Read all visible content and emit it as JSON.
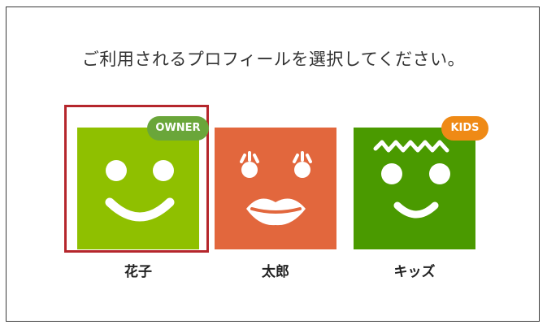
{
  "prompt": "ご利用されるプロフィールを選択してください。",
  "colors": {
    "selected_border": "#b5262c",
    "owner_avatar": "#8fc000",
    "taro_avatar": "#e2673d",
    "kids_avatar": "#4a9a00",
    "owner_badge": "#6aa63a",
    "kids_badge": "#ef8a16"
  },
  "profiles": [
    {
      "name": "花子",
      "badge": "OWNER",
      "icon": "smiley-face-icon",
      "selected": true
    },
    {
      "name": "太郎",
      "badge": "",
      "icon": "lips-face-icon",
      "selected": false
    },
    {
      "name": "キッズ",
      "badge": "KIDS",
      "icon": "kid-face-icon",
      "selected": false
    }
  ]
}
